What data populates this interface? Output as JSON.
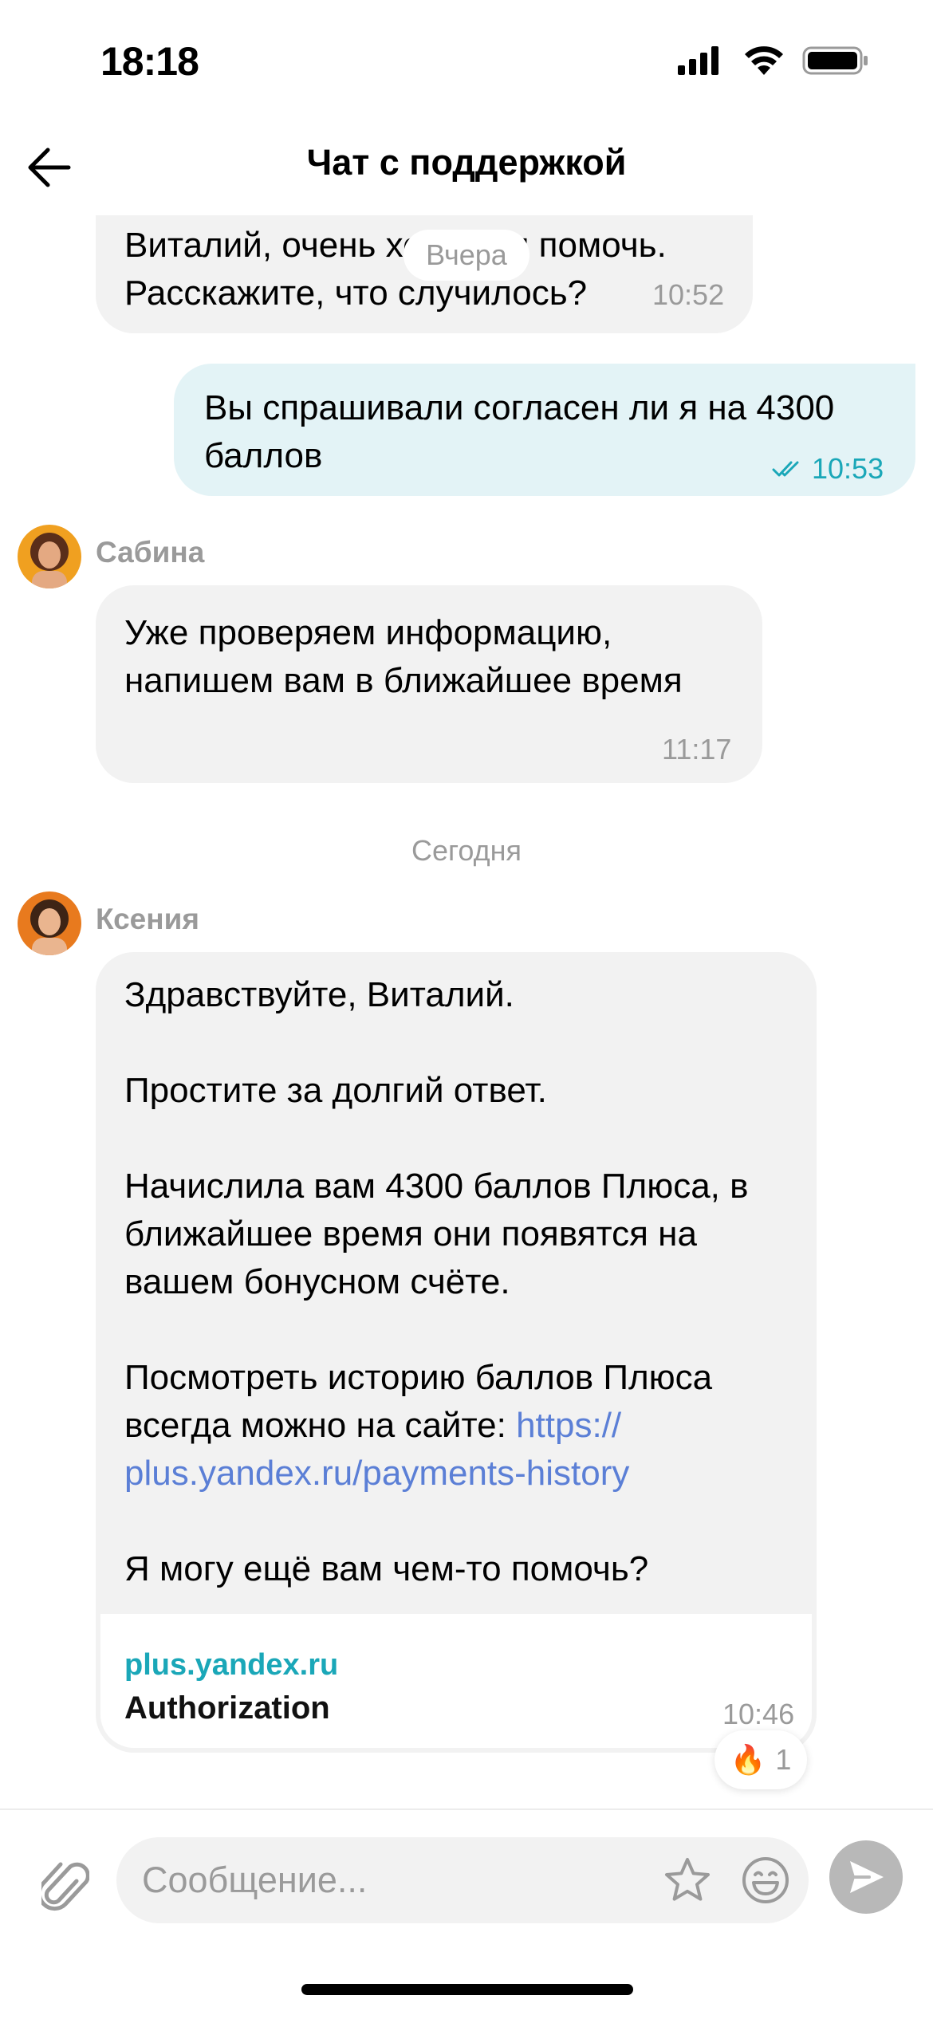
{
  "status_bar": {
    "time": "18:18"
  },
  "header": {
    "title": "Чат с поддержкой"
  },
  "messages": [
    {
      "sender": "",
      "text": "Виталий, очень хочу вам помочь.\nРасскажите, что случилось?",
      "time": "10:52",
      "direction": "in"
    },
    {
      "text": "Вы спрашивали согласен ли я на 4300\nбаллов",
      "time": "10:53",
      "direction": "out",
      "status": "read"
    },
    {
      "sender": "Сабина",
      "text": "Уже проверяем информацию,\nнапишем вам в ближайшее время",
      "time": "11:17",
      "direction": "in"
    },
    {
      "sender": "Ксения",
      "text_before_link": "Здравствуйте, Виталий.\n\nПростите за долгий ответ.\n\nНачислила вам 4300 баллов Плюса, в\nближайшее время они появятся на\nвашем бонусном счёте.\n\nПосмотреть историю баллов Плюса\nвсегда можно на сайте: ",
      "link": "https://\nplus.yandex.ru/payments-history",
      "text_after_link": "\n\nЯ могу ещё вам чем-то помочь?",
      "preview_host": "plus.yandex.ru",
      "preview_title": "Authorization",
      "time": "10:46",
      "direction": "in",
      "reaction": {
        "emoji": "🔥",
        "count": "1"
      }
    }
  ],
  "day_separators": {
    "yesterday": "Вчера",
    "today": "Сегодня"
  },
  "composer": {
    "placeholder": "Сообщение..."
  },
  "colors": {
    "outgoing_bubble": "#e3f3f6",
    "incoming_bubble": "#f2f2f2",
    "accent": "#1aa7b8",
    "link": "#5b7fd6"
  }
}
